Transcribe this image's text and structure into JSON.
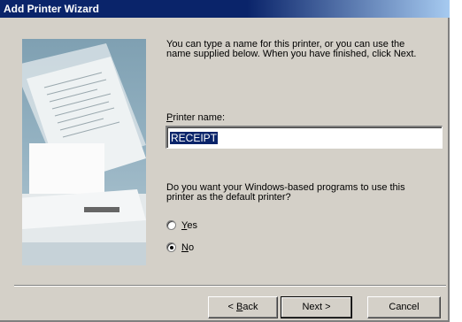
{
  "window": {
    "title": "Add Printer Wizard"
  },
  "intro": "You can type a name for this printer, or you can use the name supplied below. When you have finished, click Next.",
  "printer_name": {
    "label_prefix": "",
    "label_accel": "P",
    "label_rest": "rinter name:",
    "value": "RECEIPT"
  },
  "default_question": "Do you want your Windows-based programs to use this printer as the default printer?",
  "radios": {
    "yes": {
      "accel": "Y",
      "rest": "es",
      "checked": false
    },
    "no": {
      "accel": "N",
      "rest": "o",
      "checked": true
    }
  },
  "buttons": {
    "back_prefix": "< ",
    "back_accel": "B",
    "back_rest": "ack",
    "next": "Next >",
    "cancel": "Cancel"
  }
}
